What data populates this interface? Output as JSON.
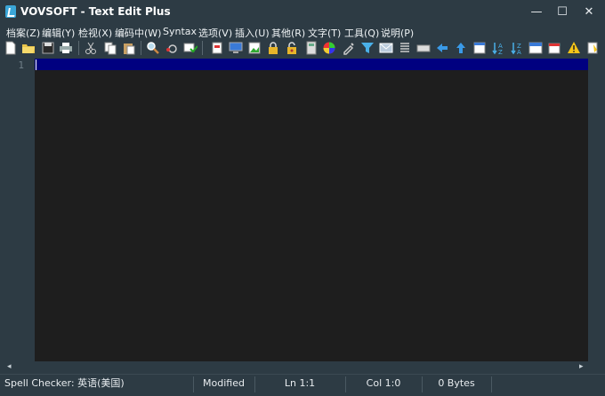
{
  "window": {
    "title": "VOVSOFT - Text Edit Plus",
    "minimize": "—",
    "maximize": "☐",
    "close": "✕"
  },
  "menu": [
    "档案(Z)",
    "编辑(Y)",
    "检视(X)",
    "编码中(W)",
    "Syntax",
    "选项(V)",
    "插入(U)",
    "其他(R)",
    "文字(T)",
    "工具(Q)",
    "说明(P)"
  ],
  "toolbar": {
    "icons": [
      "new-file-icon",
      "open-folder-icon",
      "save-icon",
      "print-icon",
      "cut-icon",
      "copy-icon",
      "paste-icon",
      "find-icon",
      "find-next-icon",
      "replace-icon",
      "bookmark-icon",
      "monitor-icon",
      "image-icon",
      "lock-icon",
      "unlock-icon",
      "calculator-icon",
      "color-picker-icon",
      "dropper-icon",
      "filter-icon",
      "email-icon",
      "list-icon",
      "keyboard-icon",
      "arrow-left-icon",
      "arrow-up-icon",
      "window-icon",
      "sort-az-icon",
      "sort-za-icon",
      "panel-icon",
      "calendar-icon",
      "warning-icon",
      "notepad-icon"
    ]
  },
  "editor": {
    "line_numbers": [
      "1"
    ],
    "content": ""
  },
  "scroll": {
    "left": "◂",
    "right": "▸"
  },
  "status": {
    "spell": "Spell Checker: 英语(美国)",
    "modified": "Modified",
    "line": "Ln 1:1",
    "col": "Col 1:0",
    "bytes": "0 Bytes"
  },
  "colors": {
    "chrome": "#2d3b44",
    "editor_bg": "#1e1e1e",
    "current_line": "#000080"
  }
}
